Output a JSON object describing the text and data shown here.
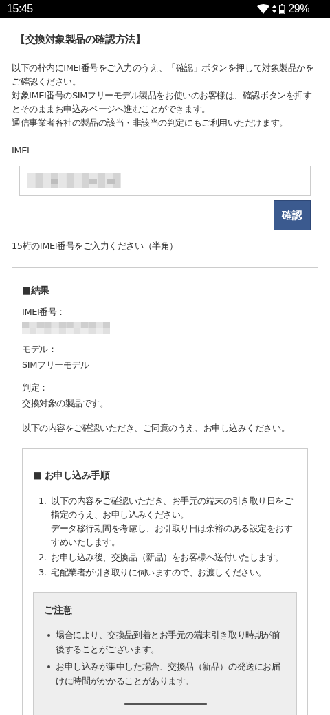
{
  "status_bar": {
    "time": "15:45",
    "battery": "29%"
  },
  "title": "【交換対象製品の確認方法】",
  "intro": [
    "以下の枠内にIMEI番号をご入力のうえ、「確認」ボタンを押して対象製品かをご確認ください。",
    "対象IMEI番号のSIMフリーモデル製品をお使いのお客様は、確認ボタンを押すとそのままお申込みページへ進むことができます。",
    "通信事業者各社の製品の該当・非該当の判定にもご利用いただけます。"
  ],
  "imei_label": "IMEI",
  "confirm_button": "確認",
  "hint": "15桁のIMEI番号をご入力ください（半角）",
  "result": {
    "heading": "■結果",
    "fields": [
      {
        "label": "IMEI番号：",
        "kind": "redacted"
      },
      {
        "label": "モデル：",
        "kind": "text",
        "value": "SIMフリーモデル"
      },
      {
        "label": "判定：",
        "kind": "text",
        "value": "交換対象の製品です。"
      }
    ],
    "note": "以下の内容をご確認いただき、ご同意のうえ、お申し込みください。"
  },
  "procedure": {
    "heading": "■ お申し込み手順",
    "steps": [
      {
        "number": "1.",
        "lines": [
          "以下の内容をご確認いただき、お手元の端末の引き取り日をご指定のうえ、お申し込みください。",
          "データ移行期間を考慮し、お引取り日は余裕のある設定をおすすめいたします。"
        ]
      },
      {
        "number": "2.",
        "lines": [
          "お申し込み後、交換品（新品）をお客様へ送付いたします。"
        ]
      },
      {
        "number": "3.",
        "lines": [
          "宅配業者が引き取りに伺いますので、お渡しください。"
        ]
      }
    ]
  },
  "caution": {
    "heading": "ご注意",
    "items": [
      "場合により、交換品到着とお手元の端末引き取り時期が前後することがございます。",
      "お申し込みが集中した場合、交換品（新品）の発送にお届けに時間がかかることがあります。"
    ]
  }
}
